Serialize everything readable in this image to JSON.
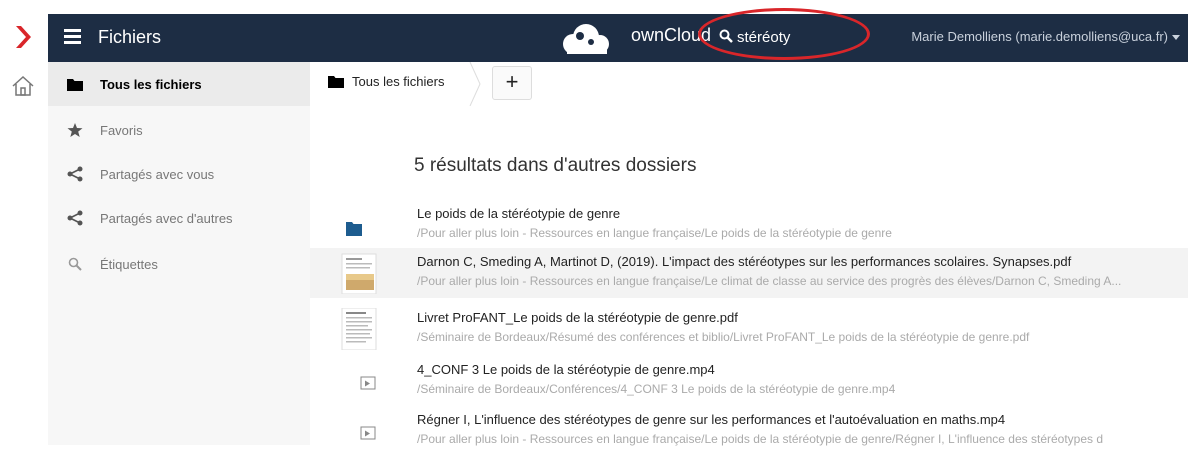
{
  "header": {
    "app_title": "Fichiers",
    "brand": "ownCloud",
    "search_value": "stéréoty",
    "user": "Marie Demolliens (marie.demolliens@uca.fr)"
  },
  "sidebar": {
    "items": [
      {
        "label": "Tous les fichiers",
        "icon": "folder-icon"
      },
      {
        "label": "Favoris",
        "icon": "star-icon"
      },
      {
        "label": "Partagés avec vous",
        "icon": "share-icon"
      },
      {
        "label": "Partagés avec d'autres",
        "icon": "share-icon"
      },
      {
        "label": "Étiquettes",
        "icon": "search-icon"
      }
    ]
  },
  "breadcrumb": {
    "label": "Tous les fichiers",
    "add_label": "+"
  },
  "results": {
    "title": "5 résultats dans d'autres dossiers",
    "items": [
      {
        "name": "Le poids de la stéréotypie de genre",
        "path": "/Pour aller plus loin - Ressources en langue française/Le poids de la stéréotypie de genre",
        "type": "folder"
      },
      {
        "name": "Darnon C, Smeding A, Martinot D, (2019). L'impact des stéréotypes sur les performances scolaires. Synapses.pdf",
        "path": "/Pour aller plus loin - Ressources en langue française/Le climat de classe au service des progrès des élèves/Darnon C, Smeding A...",
        "type": "pdf"
      },
      {
        "name": "Livret ProFANT_Le poids de la stéréotypie de genre.pdf",
        "path": "/Séminaire de Bordeaux/Résumé des conférences et biblio/Livret ProFANT_Le poids de la stéréotypie de genre.pdf",
        "type": "pdf"
      },
      {
        "name": "4_CONF 3 Le poids de la stéréotypie de genre.mp4",
        "path": "/Séminaire de Bordeaux/Conférences/4_CONF 3 Le poids de la stéréotypie de genre.mp4",
        "type": "video"
      },
      {
        "name": "Régner I, L'influence des stéréotypes de genre sur les performances et l'autoévaluation en maths.mp4",
        "path": "/Pour aller plus loin - Ressources en langue française/Le poids de la stéréotypie de genre/Régner I, L'influence des stéréotypes d",
        "type": "video"
      }
    ]
  },
  "colors": {
    "header_bg": "#1d2d44",
    "accent_chevron": "#d9262a",
    "folder_blue": "#1d5c8f",
    "highlight_circle": "#d9262a"
  }
}
